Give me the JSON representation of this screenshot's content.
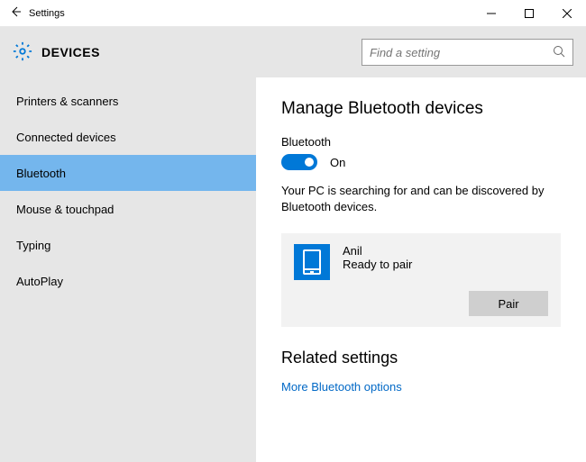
{
  "titlebar": {
    "title": "Settings"
  },
  "header": {
    "title": "DEVICES"
  },
  "search": {
    "placeholder": "Find a setting"
  },
  "sidebar": {
    "items": [
      {
        "label": "Printers & scanners"
      },
      {
        "label": "Connected devices"
      },
      {
        "label": "Bluetooth"
      },
      {
        "label": "Mouse & touchpad"
      },
      {
        "label": "Typing"
      },
      {
        "label": "AutoPlay"
      }
    ]
  },
  "content": {
    "page_title": "Manage Bluetooth devices",
    "bluetooth_label": "Bluetooth",
    "toggle_state": "On",
    "info_text": "Your PC is searching for and can be discovered by Bluetooth devices.",
    "device": {
      "name": "Anil",
      "status": "Ready to pair",
      "pair_button": "Pair"
    },
    "related_title": "Related settings",
    "more_link": "More Bluetooth options"
  }
}
